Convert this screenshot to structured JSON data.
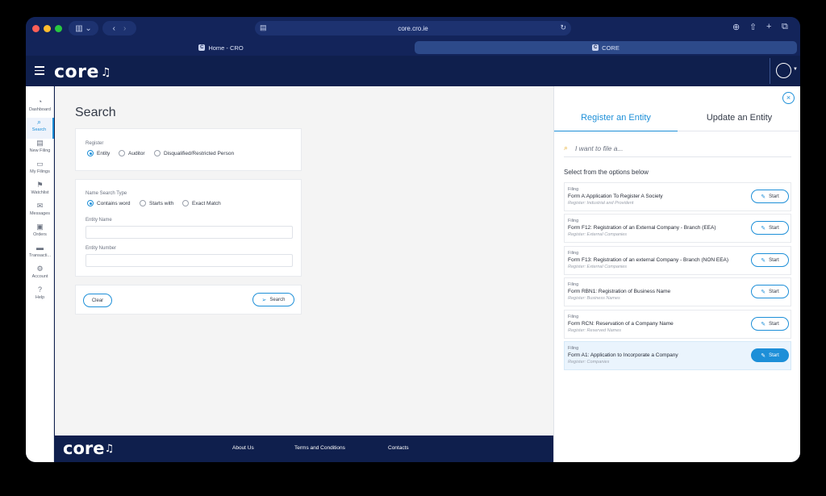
{
  "browser": {
    "url": "core.cro.ie",
    "tabs": [
      {
        "label": "Home - CRO",
        "favicon": "C"
      },
      {
        "label": "CORE",
        "favicon": "C"
      }
    ]
  },
  "header": {
    "logo_text": "core"
  },
  "sidebar": {
    "items": [
      {
        "label": "Dashboard",
        "icon": "dashboard-icon",
        "glyph": "◔"
      },
      {
        "label": "Search",
        "icon": "search-icon",
        "glyph": "⌕"
      },
      {
        "label": "New Filing",
        "icon": "new-filing-icon",
        "glyph": "▤"
      },
      {
        "label": "My Filings",
        "icon": "folder-icon",
        "glyph": "▭"
      },
      {
        "label": "Watchlist",
        "icon": "watchlist-icon",
        "glyph": "⚑"
      },
      {
        "label": "Messages",
        "icon": "mail-icon",
        "glyph": "✉"
      },
      {
        "label": "Orders",
        "icon": "orders-icon",
        "glyph": "▣"
      },
      {
        "label": "Transacti...",
        "icon": "transactions-icon",
        "glyph": "▬"
      },
      {
        "label": "Account",
        "icon": "gear-icon",
        "glyph": "⚙"
      },
      {
        "label": "Help",
        "icon": "help-icon",
        "glyph": "?"
      }
    ]
  },
  "main": {
    "title": "Search",
    "register": {
      "label": "Register",
      "options": [
        "Entity",
        "Auditor",
        "Disqualified/Restricted Person"
      ],
      "selected": "Entity"
    },
    "name_search": {
      "label": "Name Search Type",
      "options": [
        "Contains word",
        "Starts with",
        "Exact Match"
      ],
      "selected": "Contains word",
      "entity_name_label": "Entity Name",
      "entity_name_value": "",
      "entity_number_label": "Entity Number",
      "entity_number_value": ""
    },
    "actions": {
      "clear_label": "Clear",
      "search_label": "Search"
    }
  },
  "footer": {
    "logo_text": "core",
    "links": [
      "About Us",
      "Terms and Conditions",
      "Contacts"
    ]
  },
  "panel": {
    "tabs": [
      "Register an Entity",
      "Update an Entity"
    ],
    "active_tab": "Register an Entity",
    "search_placeholder": "I want to file a...",
    "heading": "Select from the options below",
    "start_label": "Start",
    "options": [
      {
        "kind": "Filing",
        "name": "Form A:Application To Register A Society",
        "register": "Register: Industrial and Provident",
        "highlight": false
      },
      {
        "kind": "Filing",
        "name": "Form F12: Registration of an External Company - Branch (EEA)",
        "register": "Register: External Companies",
        "highlight": false
      },
      {
        "kind": "Filing",
        "name": "Form F13: Registration of an external Company - Branch (NON EEA)",
        "register": "Register: External Companies",
        "highlight": false
      },
      {
        "kind": "Filing",
        "name": "Form RBN1: Registration of Business Name",
        "register": "Register: Business Names",
        "highlight": false
      },
      {
        "kind": "Filing",
        "name": "Form RCN: Reservation of a Company Name",
        "register": "Register: Reserved Names",
        "highlight": false
      },
      {
        "kind": "Filing",
        "name": "Form A1: Application to Incorporate a Company",
        "register": "Register: Companies",
        "highlight": true
      }
    ]
  },
  "colors": {
    "navy": "#0f1f4d",
    "accent": "#1d8fd8"
  }
}
